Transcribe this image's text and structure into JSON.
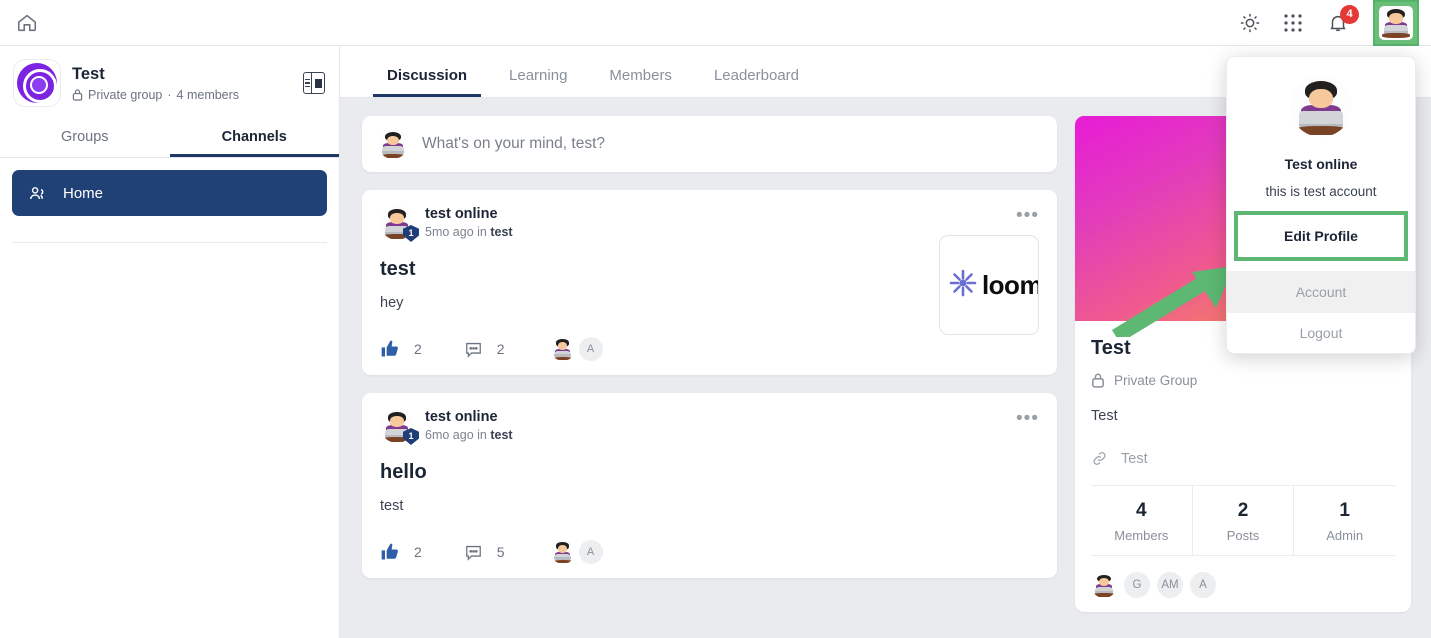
{
  "topbar": {
    "home_icon": "home-icon",
    "theme_icon": "sun-icon",
    "apps_icon": "grid-apps-icon",
    "bell_icon": "bell-icon",
    "notification_count": "4"
  },
  "sidebar": {
    "group_name": "Test",
    "group_privacy": "Private group",
    "group_separator": "·",
    "group_members": "4 members",
    "panel_toggle_icon": "panel-collapse-icon",
    "tabs": [
      {
        "label": "Groups",
        "active": false
      },
      {
        "label": "Channels",
        "active": true
      }
    ],
    "channels": [
      {
        "label": "Home",
        "icon": "people-icon",
        "active": true
      }
    ]
  },
  "main": {
    "tabs": [
      {
        "label": "Discussion",
        "active": true
      },
      {
        "label": "Learning",
        "active": false
      },
      {
        "label": "Members",
        "active": false
      },
      {
        "label": "Leaderboard",
        "active": false
      }
    ],
    "composer": {
      "placeholder": "What's on your mind, test?"
    },
    "posts": [
      {
        "author": "test online",
        "time": "5mo ago in ",
        "channel": "test",
        "title": "test",
        "body": "hey",
        "likes": "2",
        "comments": "2",
        "badge": "1",
        "reaction_chip": "A",
        "attachment": "loom"
      },
      {
        "author": "test online",
        "time": "6mo ago in ",
        "channel": "test",
        "title": "hello",
        "body": "test",
        "likes": "2",
        "comments": "5",
        "badge": "1",
        "reaction_chip": "A",
        "attachment": ""
      }
    ]
  },
  "right_panel": {
    "title": "Test",
    "privacy": "Private Group",
    "description": "Test",
    "link": "Test",
    "stats": [
      {
        "value": "4",
        "label": "Members"
      },
      {
        "value": "2",
        "label": "Posts"
      },
      {
        "value": "1",
        "label": "Admin"
      }
    ],
    "member_chips": [
      "G",
      "AM",
      "A"
    ]
  },
  "dropdown": {
    "name": "Test online",
    "bio": "this is test account",
    "edit_profile": "Edit Profile",
    "account": "Account",
    "logout": "Logout"
  },
  "colors": {
    "accent_navy": "#1f4176",
    "highlight_green": "#5cb872",
    "badge_red": "#e53935",
    "like_blue": "#2f5fa8",
    "group_purple": "#7b23e0"
  }
}
